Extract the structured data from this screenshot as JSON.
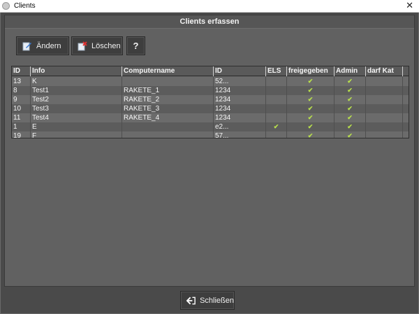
{
  "window": {
    "title": "Clients",
    "close_glyph": "✕"
  },
  "panel": {
    "title": "Clients erfassen"
  },
  "toolbar": {
    "edit_label": "Ändern",
    "delete_label": "Löschen",
    "help_label": "?"
  },
  "table": {
    "columns": [
      "ID",
      "Info",
      "Computername",
      "ID",
      "ELS",
      "freigegeben",
      "Admin",
      "darf Kat"
    ],
    "rows": [
      {
        "id": "13",
        "info": "K",
        "computer": "",
        "cid": "52...",
        "els": "",
        "freigegeben": "✔",
        "admin": "✔",
        "kat": ""
      },
      {
        "id": "8",
        "info": "Test1",
        "computer": "RAKETE_1",
        "cid": "1234",
        "els": "",
        "freigegeben": "✔",
        "admin": "✔",
        "kat": ""
      },
      {
        "id": "9",
        "info": "Test2",
        "computer": "RAKETE_2",
        "cid": "1234",
        "els": "",
        "freigegeben": "✔",
        "admin": "✔",
        "kat": ""
      },
      {
        "id": "10",
        "info": "Test3",
        "computer": "RAKETE_3",
        "cid": "1234",
        "els": "",
        "freigegeben": "✔",
        "admin": "✔",
        "kat": ""
      },
      {
        "id": "11",
        "info": "Test4",
        "computer": "RAKETE_4",
        "cid": "1234",
        "els": "",
        "freigegeben": "✔",
        "admin": "✔",
        "kat": ""
      },
      {
        "id": "1",
        "info": "E",
        "computer": "",
        "cid": "e2...",
        "els": "✔",
        "freigegeben": "✔",
        "admin": "✔",
        "kat": ""
      },
      {
        "id": "19",
        "info": "F",
        "computer": "",
        "cid": "57...",
        "els": "",
        "freigegeben": "✔",
        "admin": "✔",
        "kat": ""
      }
    ]
  },
  "footer": {
    "close_label": "Schließen"
  },
  "colors": {
    "check": "#b8e04c",
    "panel": "#616161",
    "background": "#4a4a4a"
  }
}
